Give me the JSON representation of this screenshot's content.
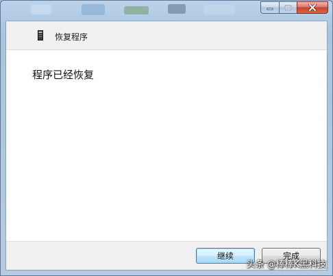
{
  "window": {
    "controls": {
      "minimize_icon": "minimize-icon",
      "maximize_icon": "maximize-icon",
      "close_icon": "close-icon"
    },
    "colors": {
      "close_button": "#c8442b",
      "frame": "#a9c3de"
    }
  },
  "header": {
    "icon": "program-icon",
    "title": "恢复程序"
  },
  "main": {
    "message": "程序已经恢复"
  },
  "footer": {
    "continue_label": "继续",
    "finish_label": "完成"
  },
  "watermark": {
    "text": "头条 @棒棒K黑科技"
  }
}
